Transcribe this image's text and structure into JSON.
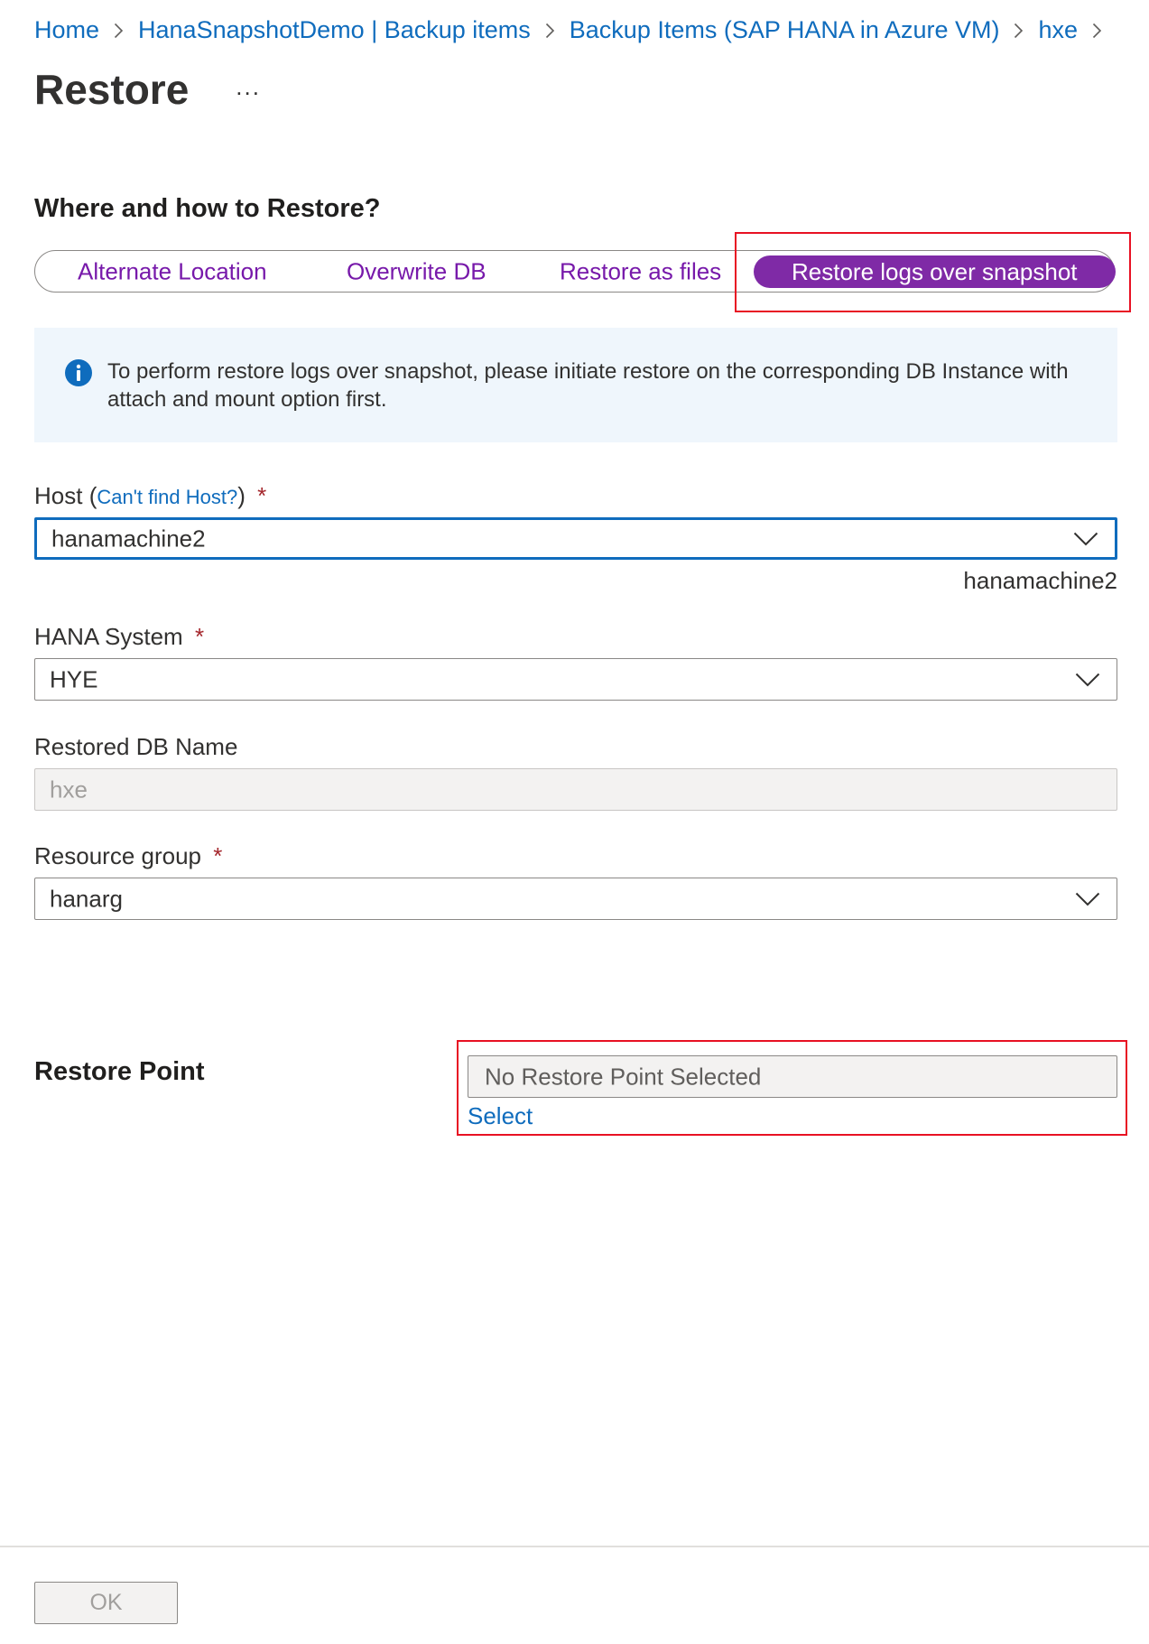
{
  "breadcrumb": [
    {
      "label": "Home"
    },
    {
      "label": "HanaSnapshotDemo | Backup items"
    },
    {
      "label": "Backup Items (SAP HANA in Azure VM)"
    },
    {
      "label": "hxe"
    }
  ],
  "page": {
    "title": "Restore",
    "more_label": "..."
  },
  "section": {
    "heading": "Where and how to Restore?"
  },
  "restore_options": {
    "options": [
      {
        "label": "Alternate Location",
        "selected": false
      },
      {
        "label": "Overwrite DB",
        "selected": false
      },
      {
        "label": "Restore as files",
        "selected": false
      },
      {
        "label": "Restore logs over snapshot",
        "selected": true
      }
    ]
  },
  "info_banner": {
    "icon": "info-icon",
    "text": "To perform restore logs over snapshot, please initiate restore on the corresponding DB Instance with attach and mount option first."
  },
  "host": {
    "label": "Host",
    "link_open": "(",
    "link_text": "Can't find Host?",
    "link_close": ")",
    "required_mark": "*",
    "value": "hanamachine2",
    "helper": "hanamachine2"
  },
  "hana_system": {
    "label": "HANA System",
    "required_mark": "*",
    "value": "HYE"
  },
  "restored_db": {
    "label": "Restored DB Name",
    "value": "hxe"
  },
  "resource_group": {
    "label": "Resource group",
    "required_mark": "*",
    "value": "hanarg"
  },
  "restore_point": {
    "label": "Restore Point",
    "value": "No Restore Point Selected",
    "select_label": "Select"
  },
  "footer": {
    "ok_label": "OK"
  },
  "colors": {
    "link": "#0f6cbd",
    "accent_purple": "#7f2aa6",
    "highlight_red": "#e81123",
    "required_red": "#a4262c",
    "info_bg": "#eff6fc"
  }
}
